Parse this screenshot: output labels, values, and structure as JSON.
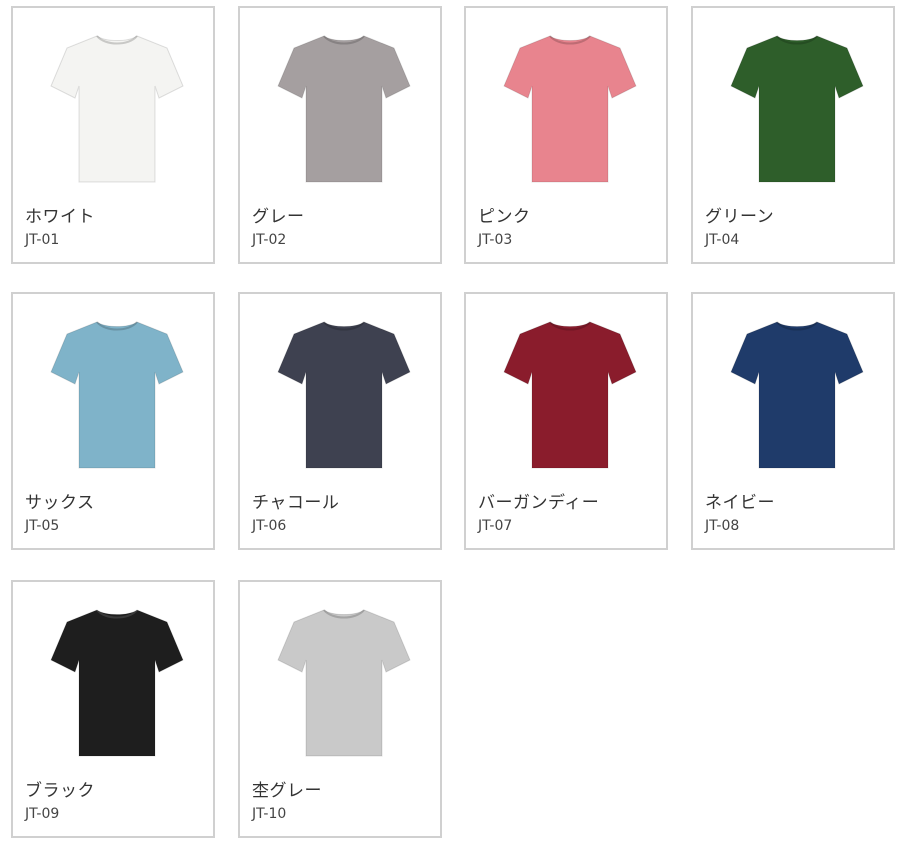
{
  "products": [
    {
      "name": "ホワイト",
      "code": "JT-01",
      "color": "#f4f4f2",
      "icon": "white-tshirt-icon"
    },
    {
      "name": "グレー",
      "code": "JT-02",
      "color": "#a59fa0",
      "icon": "gray-tshirt-icon"
    },
    {
      "name": "ピンク",
      "code": "JT-03",
      "color": "#e8848e",
      "icon": "pink-tshirt-icon"
    },
    {
      "name": "グリーン",
      "code": "JT-04",
      "color": "#2e5e2a",
      "icon": "green-tshirt-icon"
    },
    {
      "name": "サックス",
      "code": "JT-05",
      "color": "#7fb3c9",
      "icon": "sax-tshirt-icon"
    },
    {
      "name": "チャコール",
      "code": "JT-06",
      "color": "#3e4150",
      "icon": "charcoal-tshirt-icon"
    },
    {
      "name": "バーガンディー",
      "code": "JT-07",
      "color": "#8a1c2c",
      "icon": "burgundy-tshirt-icon"
    },
    {
      "name": "ネイビー",
      "code": "JT-08",
      "color": "#1f3b6a",
      "icon": "navy-tshirt-icon"
    },
    {
      "name": "ブラック",
      "code": "JT-09",
      "color": "#1e1e1e",
      "icon": "black-tshirt-icon"
    },
    {
      "name": "杢グレー",
      "code": "JT-10",
      "color": "#c9c9c9",
      "icon": "heather-gray-tshirt-icon"
    }
  ]
}
